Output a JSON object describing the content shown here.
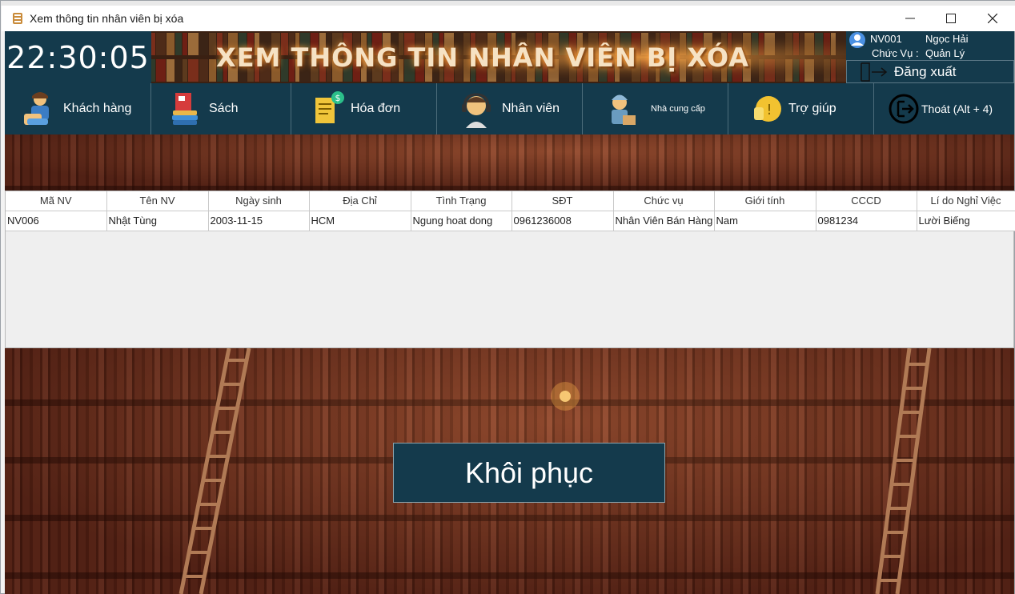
{
  "window": {
    "title": "Xem thông tin nhân viên bị xóa",
    "minimize_icon": "minimize-icon",
    "maximize_icon": "maximize-icon",
    "close_icon": "close-icon"
  },
  "header": {
    "clock": "22:30:05",
    "banner_title": "XEM THÔNG TIN NHÂN VIÊN BỊ XÓA",
    "user": {
      "id": "NV001",
      "name": "Ngọc Hải",
      "role_label": "Chức Vụ :",
      "role_value": "Quản Lý"
    },
    "logout_label": "Đăng xuất"
  },
  "nav": {
    "items": [
      {
        "label": "Khách hàng",
        "icon": "customer-icon"
      },
      {
        "label": "Sách",
        "icon": "books-icon"
      },
      {
        "label": "Hóa đơn",
        "icon": "invoice-icon"
      },
      {
        "label": "Nhân viên",
        "icon": "employee-icon"
      },
      {
        "label": "Nhà cung cấp",
        "icon": "supplier-icon"
      },
      {
        "label": "Trợ giúp",
        "icon": "help-icon"
      },
      {
        "label": "Thoát (Alt + 4)",
        "icon": "exit-icon"
      }
    ]
  },
  "table": {
    "columns": [
      "Mã NV",
      "Tên NV",
      "Ngày sinh",
      "Địa Chỉ",
      "Tình Trạng",
      "SĐT",
      "Chức vụ",
      "Giới tính",
      "CCCD",
      "Lí do Nghỉ Việc"
    ],
    "rows": [
      [
        "NV006",
        "Nhật Tùng",
        "2003-11-15",
        "HCM",
        "Ngung hoat dong",
        "0961236008",
        "Nhân Viên Bán Hàng",
        "Nam",
        "0981234",
        "Lười Biếng"
      ]
    ]
  },
  "actions": {
    "restore_label": "Khôi phục"
  },
  "colors": {
    "panel": "#143a4c",
    "shelf": "#6b2f1e"
  }
}
